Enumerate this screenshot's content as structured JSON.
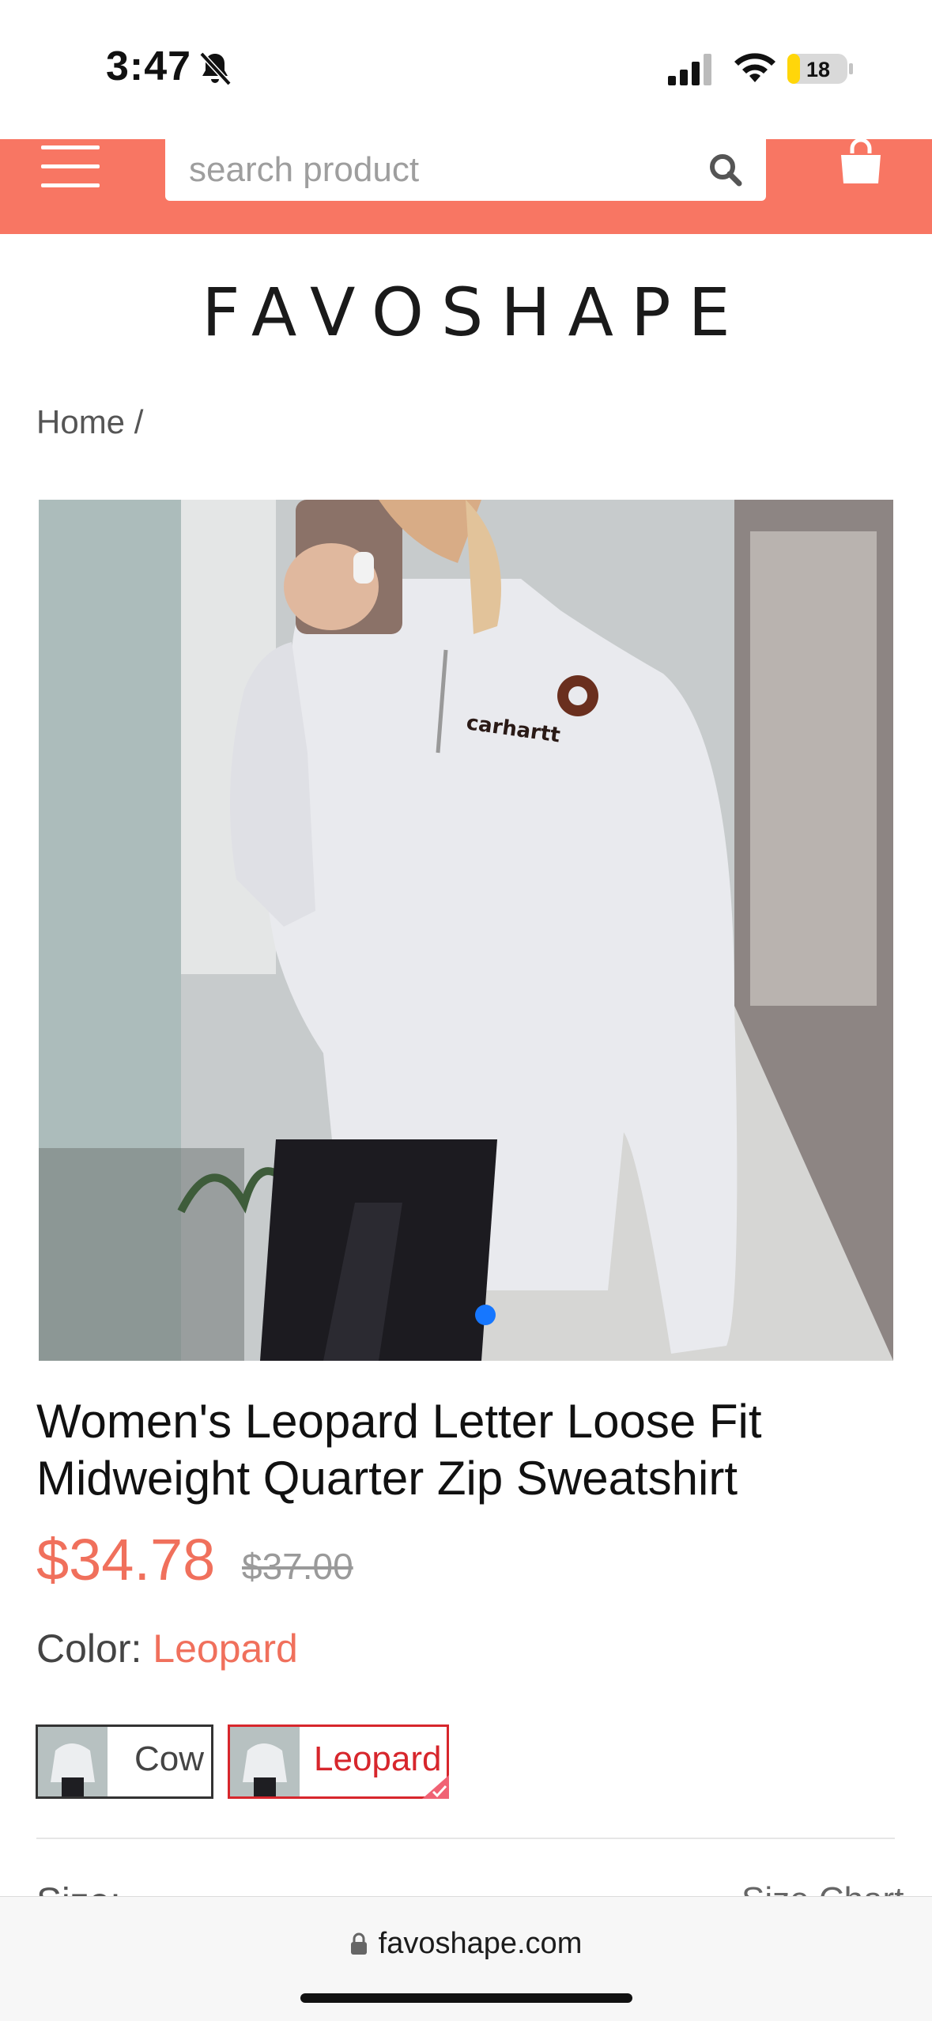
{
  "status_bar": {
    "time": "3:47",
    "battery": "18",
    "battery_color": "#ffd60a"
  },
  "header": {
    "search_placeholder": "search product",
    "bg_color": "#f87663"
  },
  "brand": {
    "logo_text": "FAVOSHAPE"
  },
  "breadcrumb": {
    "text": "Home /"
  },
  "product": {
    "title": "Women's Leopard Letter Loose Fit Midweight Quarter Zip Sweatshirt",
    "price": "$34.78",
    "old_price": "$37.00",
    "price_color": "#f0705c",
    "image_brand_text": "carhartt",
    "carousel_active_index": 0
  },
  "color_option": {
    "label": "Color:",
    "selected": "Leopard",
    "swatches": [
      {
        "label": "Cow",
        "selected": false
      },
      {
        "label": "Leopard",
        "selected": true
      }
    ]
  },
  "size_option": {
    "label": "Size:",
    "chart_link": "Size Chart"
  },
  "browser": {
    "url": "favoshape.com"
  },
  "icons": [
    "bell-slash-icon",
    "signal-icon",
    "wifi-icon",
    "battery-icon",
    "menu-icon",
    "search-icon",
    "shopping-bag-icon",
    "check-icon",
    "lock-icon"
  ]
}
